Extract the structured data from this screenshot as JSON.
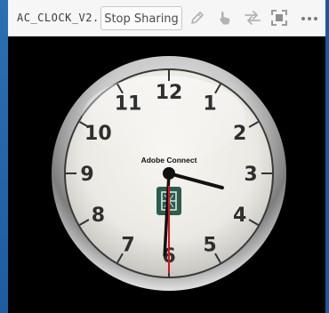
{
  "toolbar": {
    "pod_title": "AC_CLOCK_V2...",
    "stop_sharing_label": "Stop Sharing",
    "icons": [
      "pencil-icon",
      "hand-pointer-icon",
      "swap-arrows-icon",
      "fullscreen-icon",
      "more-options-icon"
    ]
  },
  "clock": {
    "brand_label": "Adobe Connect",
    "numerals": [
      "12",
      "1",
      "2",
      "3",
      "4",
      "5",
      "6",
      "7",
      "8",
      "9",
      "10",
      "11"
    ],
    "time_hour": 3,
    "time_minute": 30,
    "time_second": 30
  },
  "colors": {
    "frame_blue": "#1b5a9c",
    "second_hand": "#d8141c",
    "logo_green": "#2d5c4e"
  }
}
